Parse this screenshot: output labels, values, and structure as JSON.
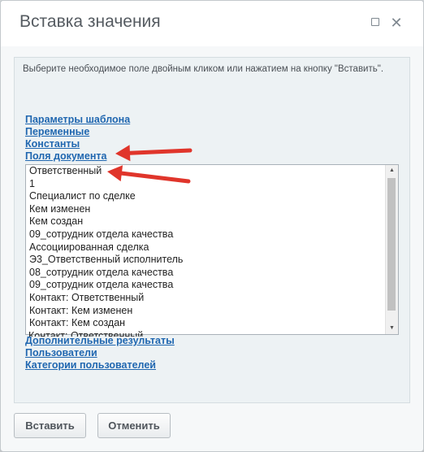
{
  "dialog": {
    "title": "Вставка значения",
    "maximize_icon": "maximize-icon",
    "close_icon": "close-icon",
    "close_glyph": "✕"
  },
  "hint": "Выберите необходимое поле двойным кликом или нажатием на кнопку \"Вставить\".",
  "sections_top": [
    "Параметры шаблона",
    "Переменные",
    "Константы",
    "Поля документа"
  ],
  "list": {
    "items": [
      "Ответственный",
      "1",
      "Специалист по сделке",
      "Кем изменен",
      "Кем создан",
      "09_сотрудник отдела качества",
      "Ассоциированная сделка",
      "Э3_Ответственный исполнитель",
      "08_сотрудник отдела качества",
      "09_сотрудник отдела качества",
      "Контакт: Ответственный",
      "Контакт: Кем изменен",
      "Контакт: Кем создан"
    ],
    "partially_visible_item": "Контакт: Ответственный"
  },
  "sections_bottom": [
    "Дополнительные результаты",
    "Пользователи",
    "Категории пользователей"
  ],
  "buttons": {
    "insert": "Вставить",
    "cancel": "Отменить"
  },
  "annotation_color": "#e0352b"
}
